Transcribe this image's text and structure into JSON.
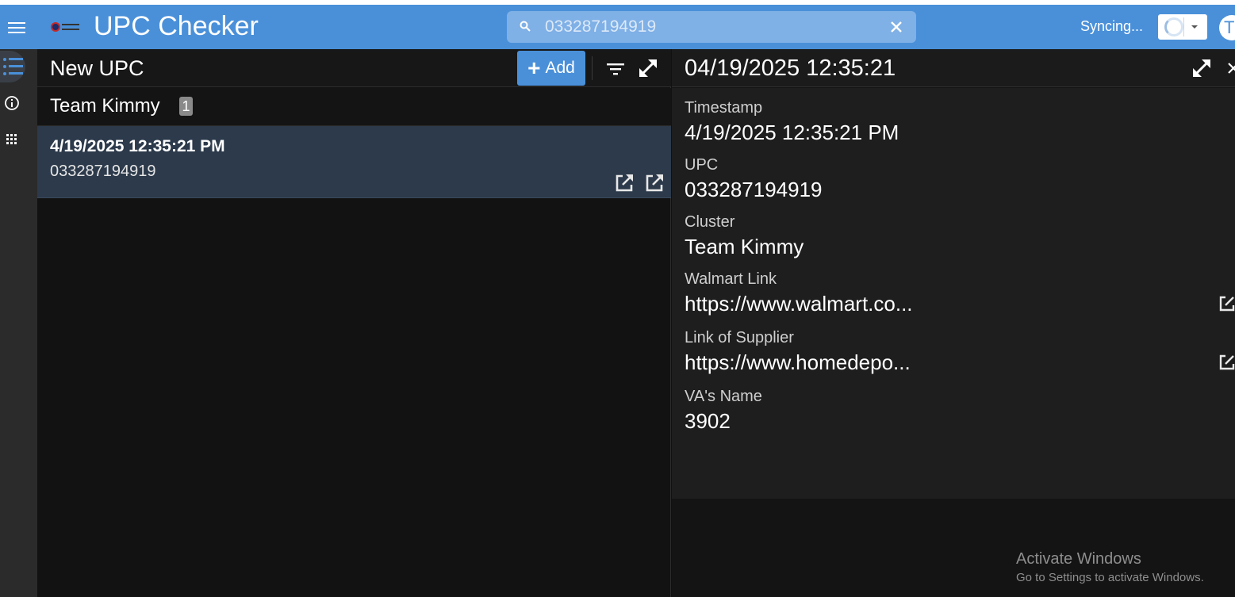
{
  "app": {
    "title": "UPC Checker",
    "accent_color": "#4a90d9"
  },
  "search": {
    "value": "033287194919",
    "placeholder": ""
  },
  "sync": {
    "status": "Syncing..."
  },
  "user": {
    "avatar_initial": "T"
  },
  "list": {
    "title": "New UPC",
    "add_label": "Add",
    "group": {
      "name": "Team Kimmy",
      "count": "1"
    },
    "items": [
      {
        "title": "4/19/2025 12:35:21 PM",
        "subtitle": "033287194919"
      }
    ]
  },
  "detail": {
    "title": "04/19/2025 12:35:21",
    "fields": [
      {
        "label": "Timestamp",
        "value": "4/19/2025 12:35:21 PM"
      },
      {
        "label": "UPC",
        "value": "033287194919"
      },
      {
        "label": "Cluster",
        "value": "Team Kimmy"
      },
      {
        "label": "Walmart Link",
        "value": "https://www.walmart.co..."
      },
      {
        "label": "Link of Supplier",
        "value": "https://www.homedepo..."
      },
      {
        "label": "VA's Name",
        "value": "3902"
      }
    ]
  },
  "watermark": {
    "title": "Activate Windows",
    "subtitle": "Go to Settings to activate Windows."
  }
}
